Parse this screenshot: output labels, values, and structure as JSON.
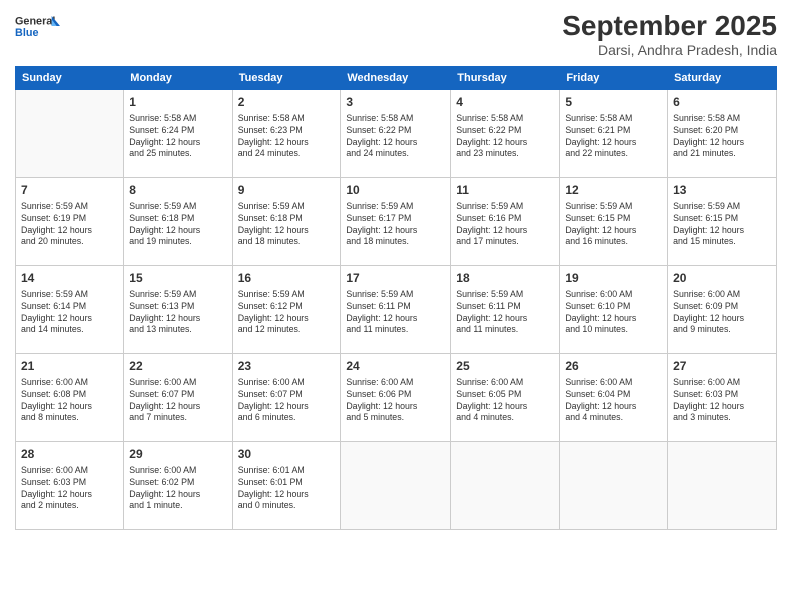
{
  "logo": {
    "line1": "General",
    "line2": "Blue"
  },
  "title": "September 2025",
  "subtitle": "Darsi, Andhra Pradesh, India",
  "days_header": [
    "Sunday",
    "Monday",
    "Tuesday",
    "Wednesday",
    "Thursday",
    "Friday",
    "Saturday"
  ],
  "weeks": [
    [
      {
        "day": "",
        "info": ""
      },
      {
        "day": "1",
        "info": "Sunrise: 5:58 AM\nSunset: 6:24 PM\nDaylight: 12 hours\nand 25 minutes."
      },
      {
        "day": "2",
        "info": "Sunrise: 5:58 AM\nSunset: 6:23 PM\nDaylight: 12 hours\nand 24 minutes."
      },
      {
        "day": "3",
        "info": "Sunrise: 5:58 AM\nSunset: 6:22 PM\nDaylight: 12 hours\nand 24 minutes."
      },
      {
        "day": "4",
        "info": "Sunrise: 5:58 AM\nSunset: 6:22 PM\nDaylight: 12 hours\nand 23 minutes."
      },
      {
        "day": "5",
        "info": "Sunrise: 5:58 AM\nSunset: 6:21 PM\nDaylight: 12 hours\nand 22 minutes."
      },
      {
        "day": "6",
        "info": "Sunrise: 5:58 AM\nSunset: 6:20 PM\nDaylight: 12 hours\nand 21 minutes."
      }
    ],
    [
      {
        "day": "7",
        "info": "Sunrise: 5:59 AM\nSunset: 6:19 PM\nDaylight: 12 hours\nand 20 minutes."
      },
      {
        "day": "8",
        "info": "Sunrise: 5:59 AM\nSunset: 6:18 PM\nDaylight: 12 hours\nand 19 minutes."
      },
      {
        "day": "9",
        "info": "Sunrise: 5:59 AM\nSunset: 6:18 PM\nDaylight: 12 hours\nand 18 minutes."
      },
      {
        "day": "10",
        "info": "Sunrise: 5:59 AM\nSunset: 6:17 PM\nDaylight: 12 hours\nand 18 minutes."
      },
      {
        "day": "11",
        "info": "Sunrise: 5:59 AM\nSunset: 6:16 PM\nDaylight: 12 hours\nand 17 minutes."
      },
      {
        "day": "12",
        "info": "Sunrise: 5:59 AM\nSunset: 6:15 PM\nDaylight: 12 hours\nand 16 minutes."
      },
      {
        "day": "13",
        "info": "Sunrise: 5:59 AM\nSunset: 6:15 PM\nDaylight: 12 hours\nand 15 minutes."
      }
    ],
    [
      {
        "day": "14",
        "info": "Sunrise: 5:59 AM\nSunset: 6:14 PM\nDaylight: 12 hours\nand 14 minutes."
      },
      {
        "day": "15",
        "info": "Sunrise: 5:59 AM\nSunset: 6:13 PM\nDaylight: 12 hours\nand 13 minutes."
      },
      {
        "day": "16",
        "info": "Sunrise: 5:59 AM\nSunset: 6:12 PM\nDaylight: 12 hours\nand 12 minutes."
      },
      {
        "day": "17",
        "info": "Sunrise: 5:59 AM\nSunset: 6:11 PM\nDaylight: 12 hours\nand 11 minutes."
      },
      {
        "day": "18",
        "info": "Sunrise: 5:59 AM\nSunset: 6:11 PM\nDaylight: 12 hours\nand 11 minutes."
      },
      {
        "day": "19",
        "info": "Sunrise: 6:00 AM\nSunset: 6:10 PM\nDaylight: 12 hours\nand 10 minutes."
      },
      {
        "day": "20",
        "info": "Sunrise: 6:00 AM\nSunset: 6:09 PM\nDaylight: 12 hours\nand 9 minutes."
      }
    ],
    [
      {
        "day": "21",
        "info": "Sunrise: 6:00 AM\nSunset: 6:08 PM\nDaylight: 12 hours\nand 8 minutes."
      },
      {
        "day": "22",
        "info": "Sunrise: 6:00 AM\nSunset: 6:07 PM\nDaylight: 12 hours\nand 7 minutes."
      },
      {
        "day": "23",
        "info": "Sunrise: 6:00 AM\nSunset: 6:07 PM\nDaylight: 12 hours\nand 6 minutes."
      },
      {
        "day": "24",
        "info": "Sunrise: 6:00 AM\nSunset: 6:06 PM\nDaylight: 12 hours\nand 5 minutes."
      },
      {
        "day": "25",
        "info": "Sunrise: 6:00 AM\nSunset: 6:05 PM\nDaylight: 12 hours\nand 4 minutes."
      },
      {
        "day": "26",
        "info": "Sunrise: 6:00 AM\nSunset: 6:04 PM\nDaylight: 12 hours\nand 4 minutes."
      },
      {
        "day": "27",
        "info": "Sunrise: 6:00 AM\nSunset: 6:03 PM\nDaylight: 12 hours\nand 3 minutes."
      }
    ],
    [
      {
        "day": "28",
        "info": "Sunrise: 6:00 AM\nSunset: 6:03 PM\nDaylight: 12 hours\nand 2 minutes."
      },
      {
        "day": "29",
        "info": "Sunrise: 6:00 AM\nSunset: 6:02 PM\nDaylight: 12 hours\nand 1 minute."
      },
      {
        "day": "30",
        "info": "Sunrise: 6:01 AM\nSunset: 6:01 PM\nDaylight: 12 hours\nand 0 minutes."
      },
      {
        "day": "",
        "info": ""
      },
      {
        "day": "",
        "info": ""
      },
      {
        "day": "",
        "info": ""
      },
      {
        "day": "",
        "info": ""
      }
    ]
  ]
}
